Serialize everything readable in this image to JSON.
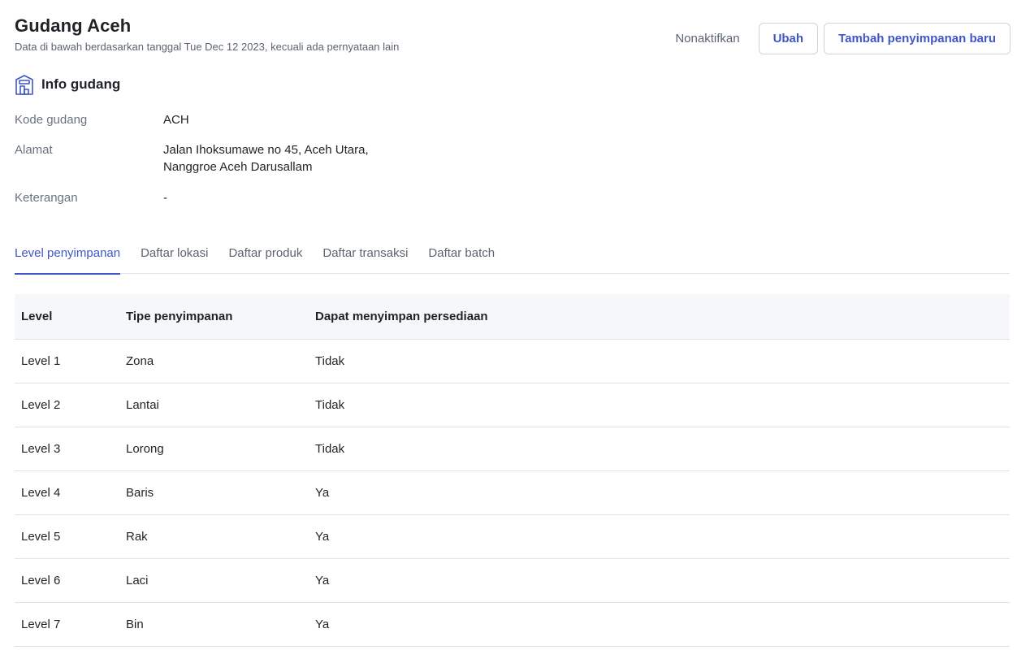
{
  "header": {
    "title": "Gudang Aceh",
    "subtitle": "Data di bawah berdasarkan tanggal Tue Dec 12 2023, kecuali ada pernyataan lain"
  },
  "actions": {
    "deactivate_label": "Nonaktifkan",
    "edit_label": "Ubah",
    "add_storage_label": "Tambah penyimpanan baru"
  },
  "info": {
    "section_title": "Info gudang",
    "section_icon": "warehouse-icon",
    "fields": [
      {
        "label": "Kode gudang",
        "value": "ACH"
      },
      {
        "label": "Alamat",
        "value": "Jalan Ihoksumawe no 45, Aceh Utara, Nanggroe Aceh Darusallam"
      },
      {
        "label": "Keterangan",
        "value": "-"
      }
    ]
  },
  "tabs": [
    {
      "label": "Level penyimpanan",
      "active": true
    },
    {
      "label": "Daftar lokasi",
      "active": false
    },
    {
      "label": "Daftar produk",
      "active": false
    },
    {
      "label": "Daftar transaksi",
      "active": false
    },
    {
      "label": "Daftar batch",
      "active": false
    }
  ],
  "table": {
    "columns": [
      "Level",
      "Tipe penyimpanan",
      "Dapat menyimpan persediaan"
    ],
    "rows": [
      [
        "Level 1",
        "Zona",
        "Tidak"
      ],
      [
        "Level 2",
        "Lantai",
        "Tidak"
      ],
      [
        "Level 3",
        "Lorong",
        "Tidak"
      ],
      [
        "Level 4",
        "Baris",
        "Ya"
      ],
      [
        "Level 5",
        "Rak",
        "Ya"
      ],
      [
        "Level 6",
        "Laci",
        "Ya"
      ],
      [
        "Level 7",
        "Bin",
        "Ya"
      ]
    ]
  },
  "colors": {
    "accent": "#3f55c8",
    "text": "#1f2328",
    "muted": "#5b6470",
    "border": "#dfe2e6",
    "table_header_bg": "#f6f7f9"
  }
}
